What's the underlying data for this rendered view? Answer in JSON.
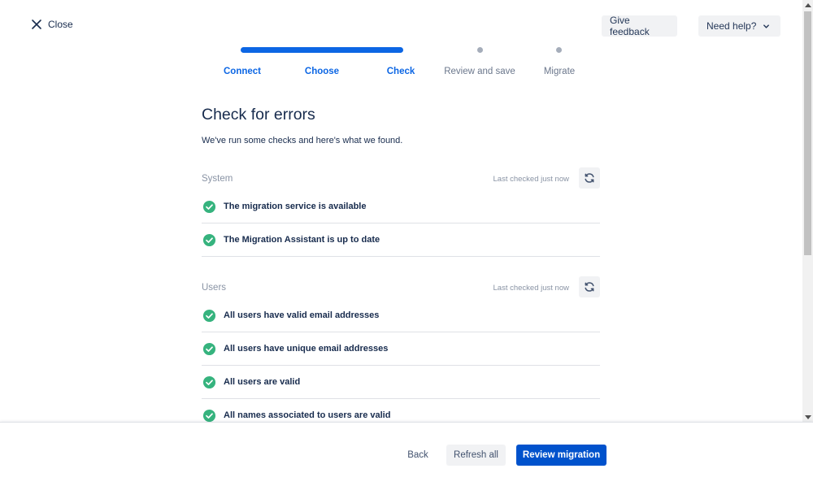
{
  "header": {
    "close_label": "Close",
    "feedback_label": "Give feedback",
    "help_label": "Need help?"
  },
  "stepper": {
    "steps": [
      {
        "label": "Connect",
        "state": "done"
      },
      {
        "label": "Choose",
        "state": "done"
      },
      {
        "label": "Check",
        "state": "current"
      },
      {
        "label": "Review and save",
        "state": "todo"
      },
      {
        "label": "Migrate",
        "state": "todo"
      }
    ]
  },
  "main": {
    "title": "Check for errors",
    "subtitle": "We've run some checks and here's what we found."
  },
  "sections": [
    {
      "title": "System",
      "last_checked": "Last checked just now",
      "checks": [
        "The migration service is available",
        "The Migration Assistant is up to date"
      ]
    },
    {
      "title": "Users",
      "last_checked": "Last checked just now",
      "checks": [
        "All users have valid email addresses",
        "All users have unique email addresses",
        "All users are valid",
        "All names associated to users are valid"
      ]
    }
  ],
  "footer": {
    "back_label": "Back",
    "refresh_all_label": "Refresh all",
    "review_label": "Review migration"
  },
  "colors": {
    "primary": "#0052CC",
    "progress": "#0C66E4",
    "success": "#36B37E",
    "text": "#172B4D",
    "muted": "#8993A4"
  },
  "icons": {
    "close": "close-icon",
    "help": "chevron-down-icon",
    "refresh": "refresh-icon",
    "check": "check-circle-icon"
  }
}
